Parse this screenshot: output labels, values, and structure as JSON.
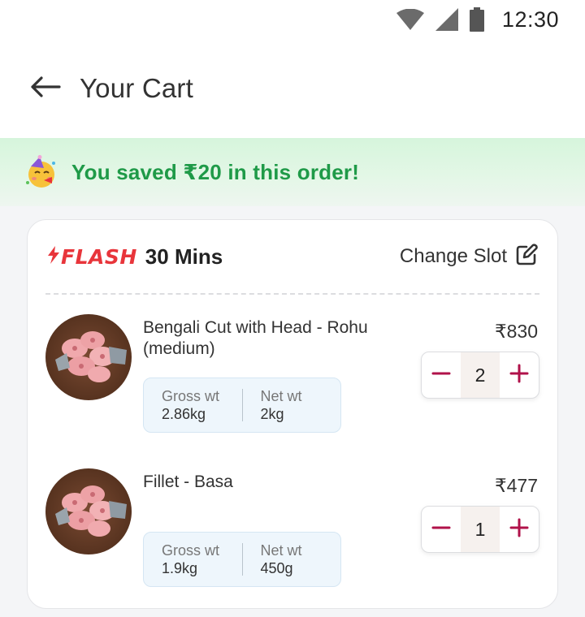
{
  "status_bar": {
    "time": "12:30",
    "icons": [
      "wifi-icon",
      "cellular-signal-icon",
      "battery-icon"
    ]
  },
  "header": {
    "back_icon": "arrow-left-icon",
    "title": "Your Cart"
  },
  "savings_banner": {
    "icon": "party-face-icon",
    "text": "You saved ₹20 in this order!",
    "color": "#1f9a48"
  },
  "slot": {
    "brand": "FLASH",
    "duration": "30 Mins",
    "change_label": "Change Slot",
    "change_icon": "edit-icon",
    "brand_color": "#e8353b"
  },
  "items": [
    {
      "name": "Bengali Cut with Head - Rohu (medium)",
      "price": "₹830",
      "gross_label": "Gross wt",
      "gross_value": "2.86kg",
      "net_label": "Net wt",
      "net_value": "2kg",
      "quantity": "2"
    },
    {
      "name": "Fillet - Basa",
      "price": "₹477",
      "gross_label": "Gross wt",
      "gross_value": "1.9kg",
      "net_label": "Net wt",
      "net_value": "450g",
      "quantity": "1"
    }
  ],
  "accent_color": "#b0124a"
}
